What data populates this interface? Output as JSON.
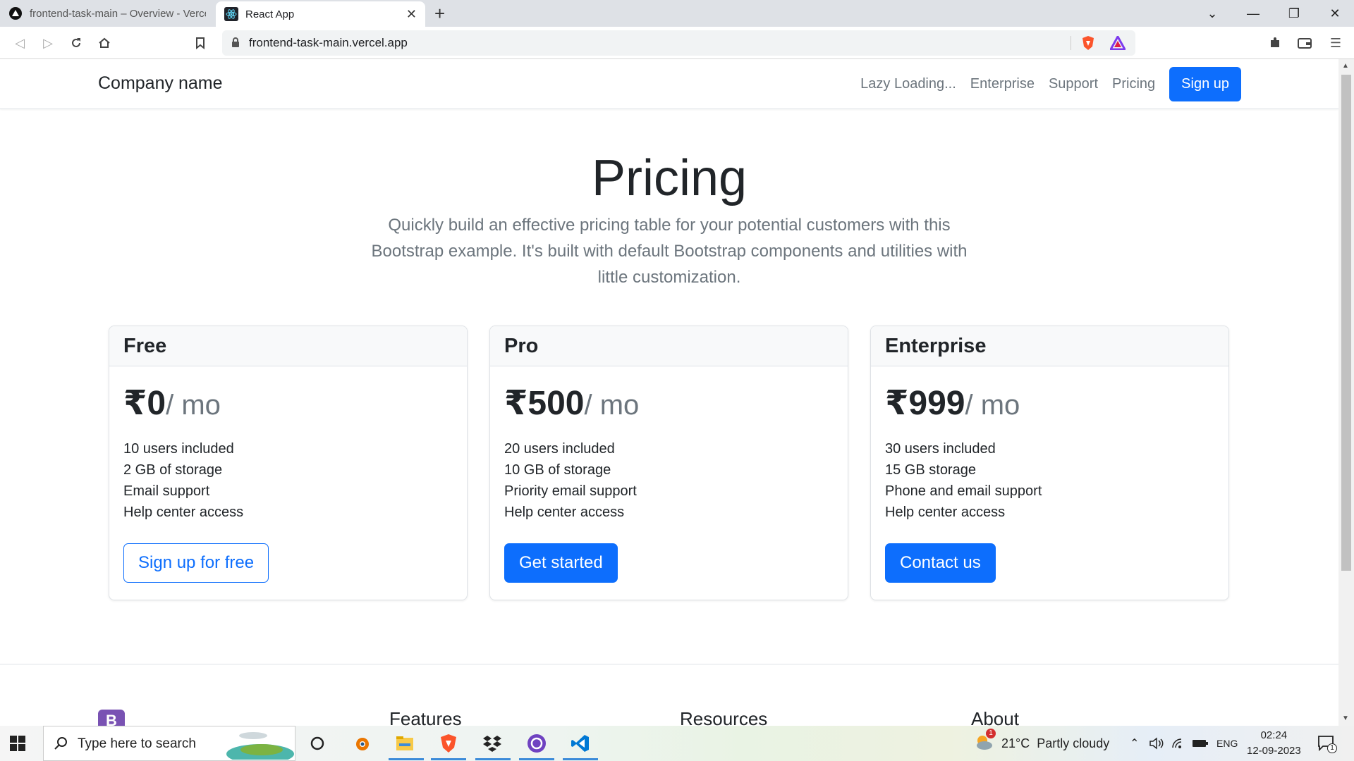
{
  "browser": {
    "tabs": [
      {
        "title": "frontend-task-main – Overview - Vercel",
        "icon": "vercel-triangle-icon"
      },
      {
        "title": "React App",
        "icon": "react-icon"
      }
    ],
    "url": "frontend-task-main.vercel.app"
  },
  "nav": {
    "brand": "Company name",
    "links": [
      "Lazy Loading...",
      "Enterprise",
      "Support",
      "Pricing"
    ],
    "signup": "Sign up"
  },
  "hero": {
    "title": "Pricing",
    "subtitle": "Quickly build an effective pricing table for your potential customers with this Bootstrap example. It's built with default Bootstrap components and utilities with little customization."
  },
  "plans": [
    {
      "name": "Free",
      "price": "₹0",
      "period": "/ mo",
      "features": [
        "10 users included",
        "2 GB of storage",
        "Email support",
        "Help center access"
      ],
      "button": "Sign up for free",
      "style": "outline"
    },
    {
      "name": "Pro",
      "price": "₹500",
      "period": "/ mo",
      "features": [
        "20 users included",
        "10 GB of storage",
        "Priority email support",
        "Help center access"
      ],
      "button": "Get started",
      "style": "primary"
    },
    {
      "name": "Enterprise",
      "price": "₹999",
      "period": "/ mo",
      "features": [
        "30 users included",
        "15 GB storage",
        "Phone and email support",
        "Help center access"
      ],
      "button": "Contact us",
      "style": "primary"
    }
  ],
  "footer": {
    "logo": "B",
    "columns": [
      "Features",
      "Resources",
      "About"
    ]
  },
  "taskbar": {
    "search_placeholder": "Type here to search",
    "weather_temp": "21°C",
    "weather_text": "Partly cloudy",
    "weather_badge": "1",
    "language": "ENG",
    "time": "02:24",
    "date": "12-09-2023",
    "notification_count": "1"
  },
  "colors": {
    "primary": "#0d6efd",
    "muted": "#6c757d",
    "text": "#212529"
  }
}
